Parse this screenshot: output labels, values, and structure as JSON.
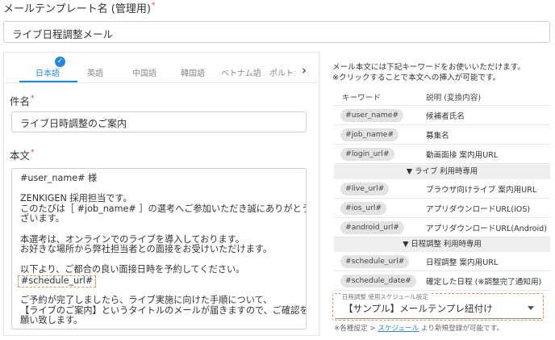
{
  "template_name": {
    "label": "メールテンプレート名 (管理用)",
    "required_mark": "*",
    "value": "ライブ日程調整メール"
  },
  "tabs": {
    "items": [
      "日本語",
      "英語",
      "中国語",
      "韓国語",
      "ベトナム語",
      "ポルトガ"
    ],
    "active": "日本語",
    "check_glyph": "✓",
    "next_glyph": "›"
  },
  "subject": {
    "label": "件名",
    "required_mark": "*",
    "value": "ライブ日時調整のご案内"
  },
  "body": {
    "label": "本文",
    "required_mark": "*",
    "lines": [
      "#user_name# 様",
      "",
      "ZENKIGEN 採用担当です。",
      "このたびは［ #job_name# ］の選考へご参加いただき誠にありがとうご",
      "ざいます。",
      "",
      "本選考は、オンラインでのライブを導入しております。",
      "お好きな場所から弊社担当者との面接をお受けいただけます。",
      "",
      "以下より、ご都合の良い面接日時を予約してください。",
      "#schedule_url#",
      "",
      "ご予約が完了しましたら、ライブ実施に向けた手順について、",
      "【ライブのご案内】というタイトルのメールが届きますので、ご確認をお",
      "願い致します。"
    ]
  },
  "keywords": {
    "intro_line1": "メール本文には下記キーワードをお使いいただけます。",
    "intro_line2": "※クリックすることで本文への挿入が可能です。",
    "header_keyword": "キーワード",
    "header_desc": "説明 (変換内容)",
    "rows": [
      {
        "key": "#user_name#",
        "desc": "候補者氏名"
      },
      {
        "key": "#job_name#",
        "desc": "募集名"
      },
      {
        "key": "#login_url#",
        "desc": "動画面接 案内用URL"
      }
    ],
    "live_section": "▼ ライブ 利用時専用",
    "live_rows": [
      {
        "key": "#live_url#",
        "desc": "ブラウザ向けライブ 案内用URL"
      },
      {
        "key": "#ios_url#",
        "desc": "アプリダウンロードURL(iOS)"
      },
      {
        "key": "#android_url#",
        "desc": "アプリダウンロードURL(Android)"
      }
    ],
    "schedule_section": "▼ 日程調整 利用時専用",
    "schedule_rows": [
      {
        "key": "#schedule_url#",
        "desc": "日程調整 案内用URL"
      },
      {
        "key": "#schedule_date#",
        "desc": "確定した日程 (※調整完了通知用)"
      }
    ]
  },
  "schedule_select": {
    "legend": "日程調整 使用スケジュール設定",
    "value": "【サンプル】メールテンプレ紐付け",
    "note_prefix": "※各種設定 > ",
    "note_link": "スケジュール",
    "note_suffix": " より新規登録が可能です。"
  },
  "colors": {
    "accent": "#1e88e5",
    "required": "#e53935",
    "highlight_dash": "#f08a3c"
  }
}
